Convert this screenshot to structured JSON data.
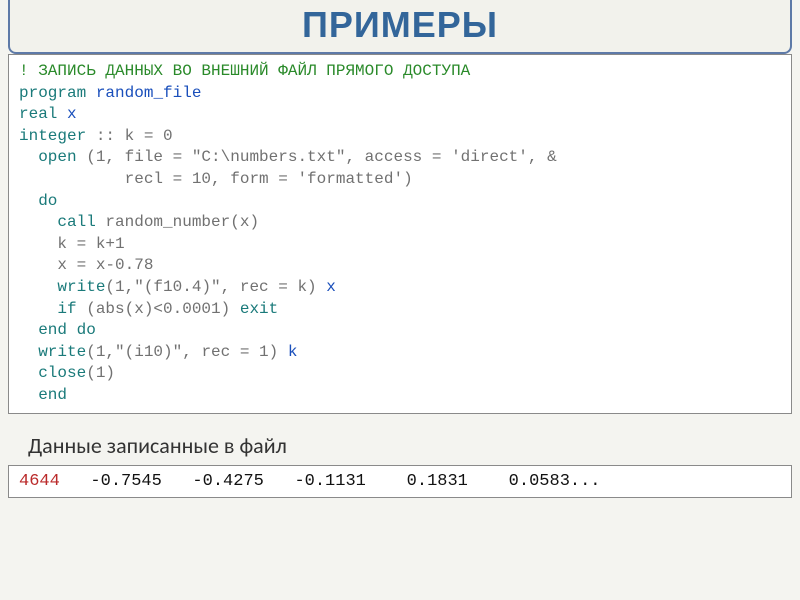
{
  "title": "ПРИМЕРЫ",
  "code": {
    "comment": "! ЗАПИСЬ ДАННЫХ ВО ВНЕШНИЙ ФАЙЛ ПРЯМОГО ДОСТУПА",
    "l1_kw": "program",
    "l1_id": "random_file",
    "l2_kw": "real",
    "l2_id": "x",
    "l3_kw": "integer",
    "l3_rest": " :: k = 0",
    "l4_kw": "  open",
    "l4_rest": " (1, file = \"C:\\numbers.txt\", access = 'direct', &",
    "l5": "           recl = 10, form = 'formatted')",
    "l6_kw": "  do",
    "l7_kw": "    call",
    "l7_rest": " random_number(x)",
    "l8": "    k = k+1",
    "l9": "    x = x-0.78",
    "l10_kw": "    write",
    "l10_mid": "(1,\"(f10.4)\", rec = k)",
    "l10_id": "x",
    "l11_kw1": "    if",
    "l11_mid": " (abs(x)<0.0001) ",
    "l11_kw2": "exit",
    "l12_kw": "  end do",
    "l13_kw": "  write",
    "l13_mid": "(1,\"(i10)\", rec = 1)",
    "l13_id": "k",
    "l14_kw": "  close",
    "l14_rest": "(1)",
    "l15_kw": "  end"
  },
  "caption": "Данные записанные в файл",
  "output": {
    "first": "4644",
    "rest": "   -0.7545   -0.4275   -0.1131    0.1831    0.0583..."
  }
}
